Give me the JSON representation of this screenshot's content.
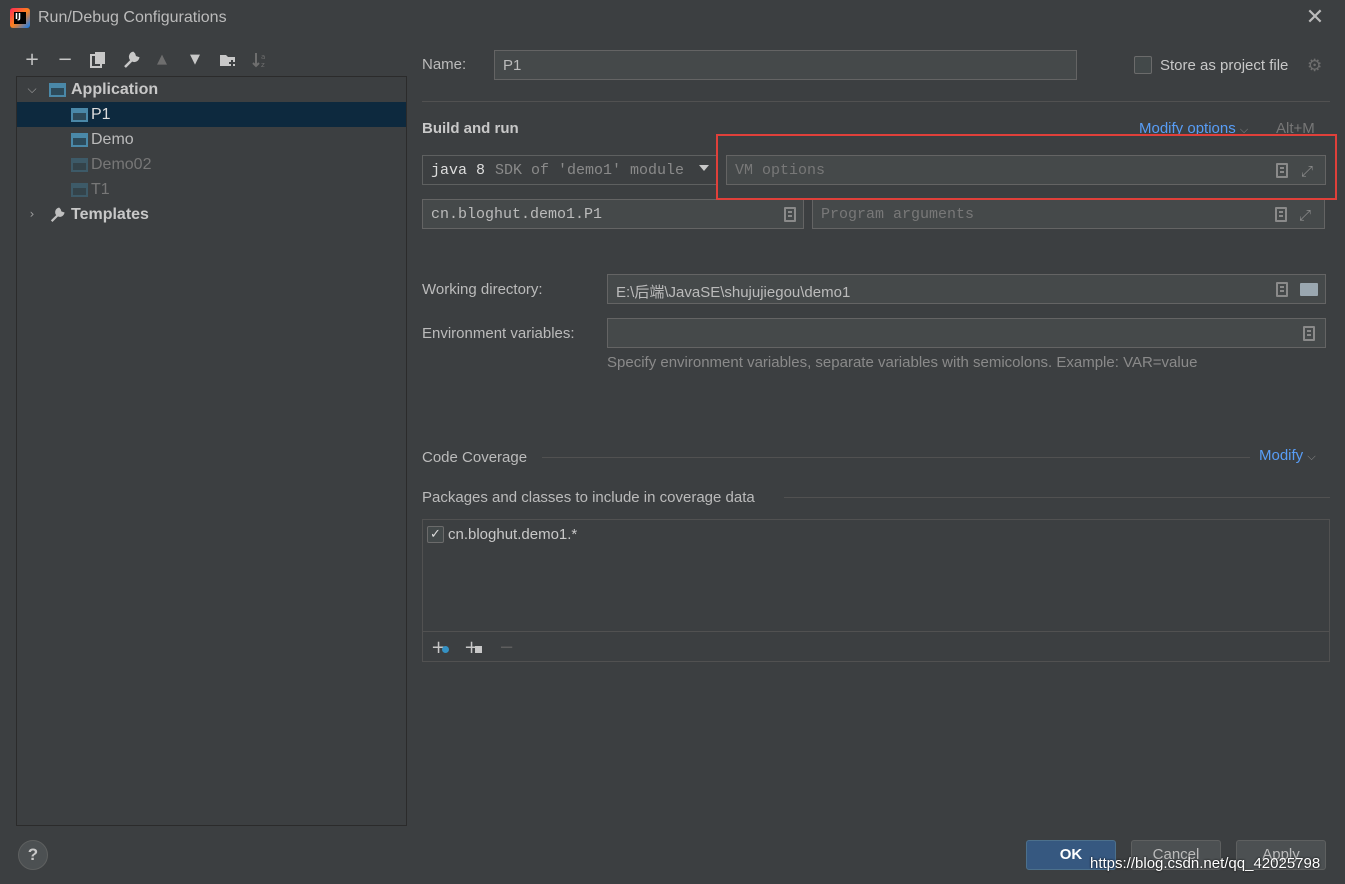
{
  "window": {
    "title": "Run/Debug Configurations",
    "close_glyph": "✕",
    "app_icon_text": "IJ"
  },
  "toolbar": {
    "add": "+",
    "remove": "−",
    "copy": "⧉",
    "edit_templates": "🔧",
    "move_up": "▲",
    "move_down": "▼",
    "new_folder": "📁",
    "sort": "↓ᵃᶻ"
  },
  "tree": {
    "application": "Application",
    "items": [
      {
        "label": "P1"
      },
      {
        "label": "Demo"
      },
      {
        "label": "Demo02"
      },
      {
        "label": "T1"
      }
    ],
    "templates": "Templates"
  },
  "name": {
    "label": "Name:",
    "value": "P1"
  },
  "store_as_project_file": {
    "label": "Store as project file",
    "checked": false
  },
  "build_and_run": {
    "title": "Build and run",
    "modify_options": "Modify options",
    "modify_shortcut": "Alt+M",
    "jdk": {
      "version": "java 8",
      "description": "SDK of 'demo1' module"
    },
    "vm_options_placeholder": "VM options",
    "main_class": "cn.bloghut.demo1.P1",
    "program_arguments_placeholder": "Program arguments"
  },
  "working_directory": {
    "label": "Working directory:",
    "value": "E:\\后端\\JavaSE\\shujujiegou\\demo1"
  },
  "environment_variables": {
    "label": "Environment variables:",
    "value": "",
    "hint": "Specify environment variables, separate variables with semicolons. Example: VAR=value"
  },
  "code_coverage": {
    "title": "Code Coverage",
    "modify": "Modify",
    "packages_title": "Packages and classes to include in coverage data",
    "entries": [
      {
        "label": "cn.bloghut.demo1.*",
        "checked": true
      }
    ]
  },
  "buttons": {
    "ok": "OK",
    "cancel": "Cancel",
    "apply": "Apply",
    "help": "?"
  },
  "watermark": "https://blog.csdn.net/qq_42025798",
  "colors": {
    "accent_link": "#589df6",
    "highlight": "#e0403a",
    "selection": "#0d293e",
    "ok_button": "#365880"
  }
}
